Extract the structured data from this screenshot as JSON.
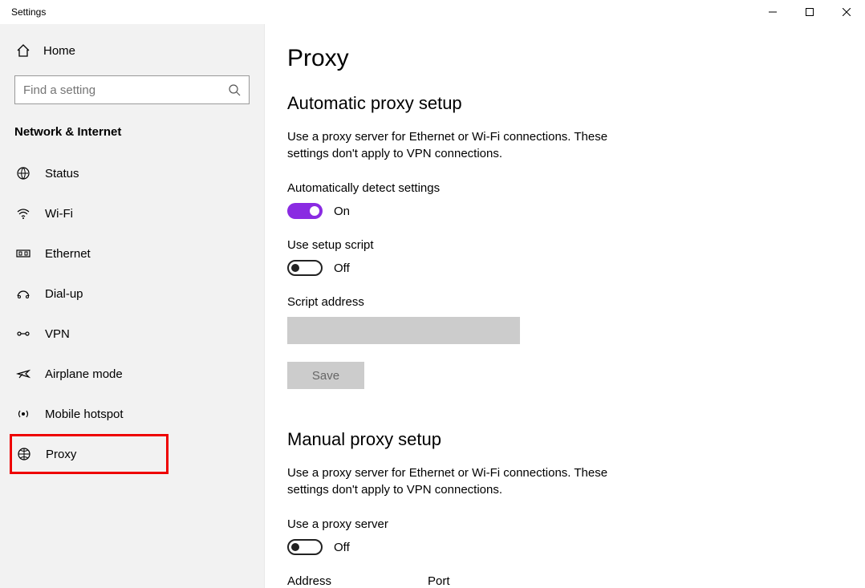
{
  "window": {
    "title": "Settings"
  },
  "sidebar": {
    "home": "Home",
    "search_placeholder": "Find a setting",
    "section": "Network & Internet",
    "items": [
      {
        "label": "Status"
      },
      {
        "label": "Wi-Fi"
      },
      {
        "label": "Ethernet"
      },
      {
        "label": "Dial-up"
      },
      {
        "label": "VPN"
      },
      {
        "label": "Airplane mode"
      },
      {
        "label": "Mobile hotspot"
      },
      {
        "label": "Proxy"
      }
    ]
  },
  "main": {
    "title": "Proxy",
    "auto_section": {
      "heading": "Automatic proxy setup",
      "desc": "Use a proxy server for Ethernet or Wi-Fi connections. These settings don't apply to VPN connections.",
      "detect_label": "Automatically detect settings",
      "detect_state": "On",
      "script_label": "Use setup script",
      "script_state": "Off",
      "script_addr_label": "Script address",
      "save": "Save"
    },
    "manual_section": {
      "heading": "Manual proxy setup",
      "desc": "Use a proxy server for Ethernet or Wi-Fi connections. These settings don't apply to VPN connections.",
      "use_label": "Use a proxy server",
      "use_state": "Off",
      "addr_label": "Address",
      "port_label": "Port"
    }
  }
}
